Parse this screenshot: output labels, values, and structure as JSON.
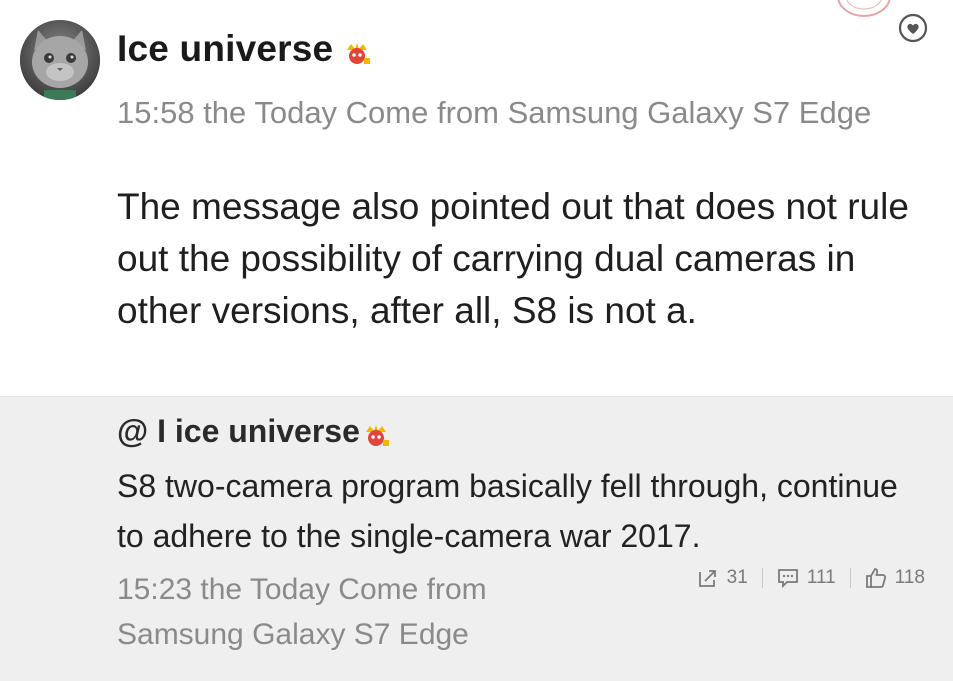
{
  "post": {
    "username": "Ice universe",
    "meta": "15:58 the Today Come from Samsung Galaxy S7 Edge",
    "body": "The message also pointed out that does not rule out the possibility of carrying dual cameras in other versions, after all, S8 is not a."
  },
  "repost": {
    "username": "@ I ice universe",
    "text": "S8 two-camera program basically fell through, continue to adhere to the single-camera war 2017.",
    "meta": "15:23 the Today Come from Samsung Galaxy S7 Edge",
    "actions": {
      "repost_count": "31",
      "comment_count": "111",
      "like_count": "118"
    }
  },
  "icons": {
    "avatar": "cat-avatar",
    "verified_badge": "crown-badge-icon",
    "follow": "heart-circle-icon",
    "repost": "share-icon",
    "comment": "comment-icon",
    "like": "thumbs-up-icon"
  },
  "colors": {
    "text": "#1f1f1f",
    "meta": "#8a8a8a",
    "repost_bg": "#efefef",
    "badge_red": "#e2433a",
    "badge_gold": "#f5b400"
  }
}
